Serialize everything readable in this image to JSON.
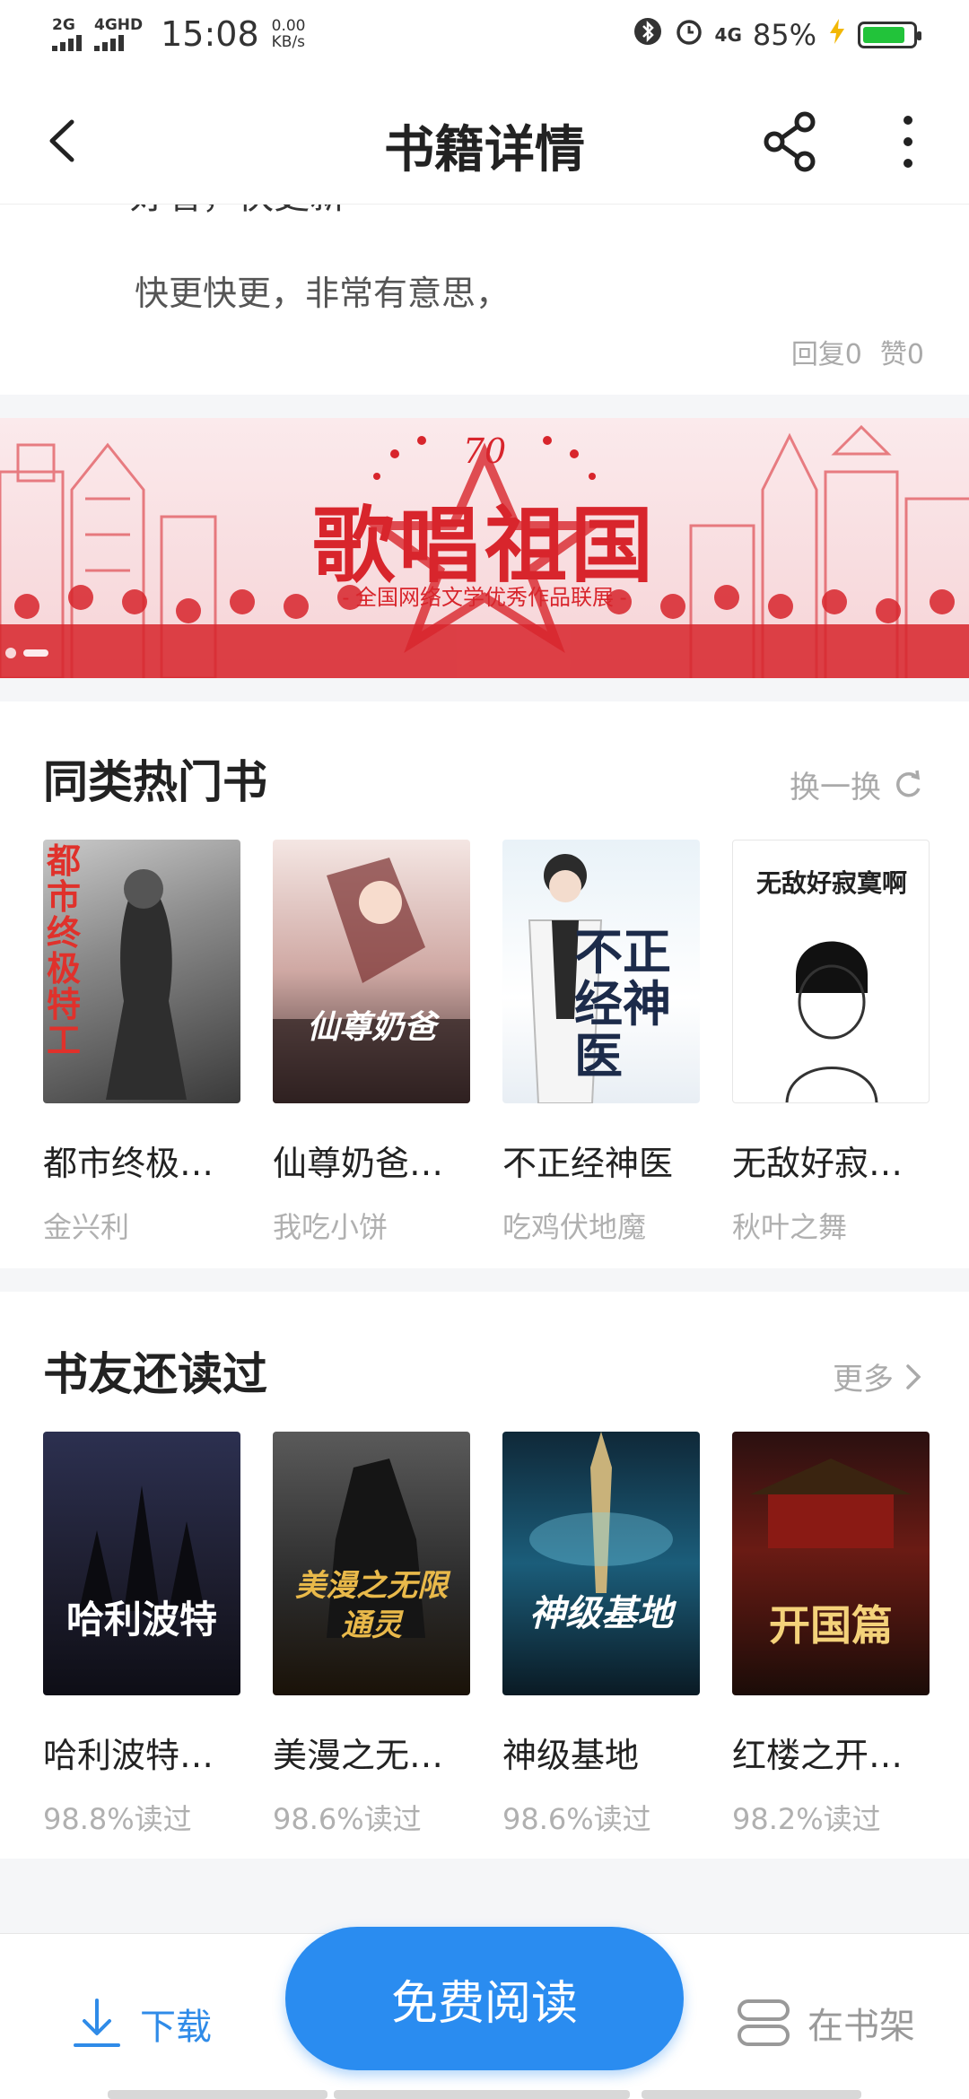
{
  "status_bar": {
    "signal1": "2G",
    "signal2": "4GHD",
    "time": "15:08",
    "speed_value": "0.00",
    "speed_unit": "KB/s",
    "network": "4G",
    "battery_pct": "85%",
    "battery_level": 0.85,
    "battery_color": "#22c33a"
  },
  "header": {
    "title": "书籍详情"
  },
  "comment": {
    "cut_text": "好看，快更新",
    "text": "快更快更，非常有意思，",
    "reply": "回复0",
    "like": "赞0"
  },
  "banner": {
    "title": "歌唱祖国",
    "subtitle": "- 全国网络文学优秀作品联展 -"
  },
  "similar": {
    "title": "同类热门书",
    "action": "换一换",
    "books": [
      {
        "name": "都市终极…",
        "author": "金兴利",
        "cover_text": "都市终极特工"
      },
      {
        "name": "仙尊奶爸…",
        "author": "我吃小饼",
        "cover_text": "仙尊奶爸"
      },
      {
        "name": "不正经神医",
        "author": "吃鸡伏地魔",
        "cover_text": "不正经神医"
      },
      {
        "name": "无敌好寂…",
        "author": "秋叶之舞",
        "cover_text": "无敌好寂寞啊"
      }
    ]
  },
  "also_read": {
    "title": "书友还读过",
    "action": "更多",
    "books": [
      {
        "name": "哈利波特…",
        "stat": "98.8%读过",
        "cover_text": "哈利波特"
      },
      {
        "name": "美漫之无…",
        "stat": "98.6%读过",
        "cover_text": "美漫之无限通灵"
      },
      {
        "name": "神级基地",
        "stat": "98.6%读过",
        "cover_text": "神级基地"
      },
      {
        "name": "红楼之开…",
        "stat": "98.2%读过",
        "cover_text": "开国篇"
      }
    ]
  },
  "bottom": {
    "download": "下载",
    "read": "免费阅读",
    "shelf": "在书架"
  },
  "colors": {
    "accent": "#2a8cf0",
    "banner_red": "#d8252c"
  }
}
